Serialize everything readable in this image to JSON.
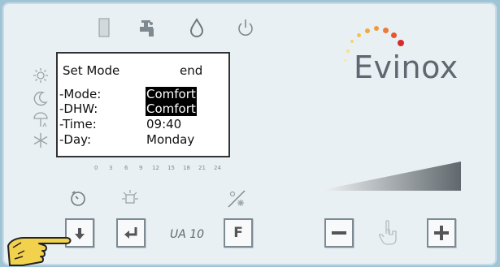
{
  "brand": {
    "name": "Evinox"
  },
  "top_icons": [
    "tank-icon",
    "tap-icon",
    "drop-icon",
    "power-icon"
  ],
  "side_icons": [
    "sun-icon",
    "moon-icon",
    "holiday-umbrella-icon",
    "frost-icon"
  ],
  "lcd": {
    "title": "Set Mode",
    "title_right": "end",
    "rows": [
      {
        "label": "-Mode:",
        "value": "Comfort"
      },
      {
        "label": "-DHW:",
        "value": "Comfort"
      },
      {
        "label": "-Time:",
        "value": "09:40"
      },
      {
        "label": "-Day:",
        "value": "Monday"
      }
    ]
  },
  "hour_scale": [
    "0",
    "3",
    "6",
    "9",
    "12",
    "15",
    "18",
    "21",
    "24"
  ],
  "model": "UA 10",
  "buttons": {
    "f_label": "F"
  },
  "colors": {
    "panel": "#e9f0f4",
    "logo_text": "#5e6870",
    "logo_dots": [
      "#f5c34a",
      "#f29a3a",
      "#e8542e",
      "#d62b26"
    ]
  }
}
